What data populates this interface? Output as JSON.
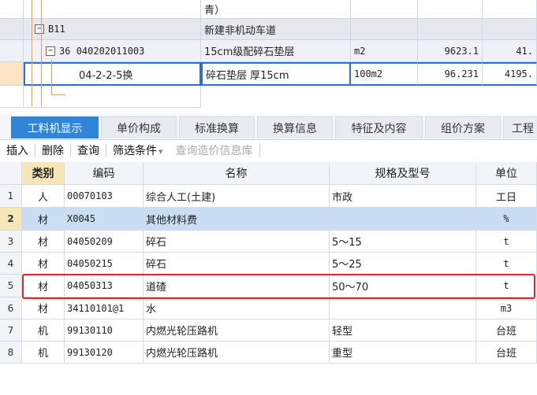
{
  "top_rows": [
    {
      "code": "",
      "name": "青）",
      "unit": "",
      "qty": "",
      "price": ""
    },
    {
      "num": "B11",
      "code": "",
      "name": "新建非机动车道",
      "unit": "",
      "qty": "",
      "price": ""
    },
    {
      "num": "36",
      "code": "040202011003",
      "name": "15cm级配碎石垫层",
      "unit": "m2",
      "qty": "9623.1",
      "price": "41."
    },
    {
      "code": "04-2-2-5换",
      "name": "碎石垫层 厚15cm",
      "unit": "100m2",
      "qty": "96.231",
      "price": "4195."
    }
  ],
  "tabs": [
    "工料机显示",
    "单价构成",
    "标准换算",
    "换算信息",
    "特征及内容",
    "组价方案",
    "工程"
  ],
  "toolbar": {
    "insert": "插入",
    "delete": "删除",
    "query": "查询",
    "filter": "筛选条件",
    "filter_arrow": "▾",
    "price_db": "查询造价信息库"
  },
  "grid_headers": {
    "category": "类别",
    "code": "编码",
    "name": "名称",
    "spec": "规格及型号",
    "unit": "单位"
  },
  "grid_rows": [
    {
      "n": "1",
      "category": "人",
      "code": "00070103",
      "name": "综合人工(土建)",
      "spec": "市政",
      "unit": "工日"
    },
    {
      "n": "2",
      "category": "材",
      "code": "X0045",
      "name": "其他材料费",
      "spec": "",
      "unit": "%"
    },
    {
      "n": "3",
      "category": "材",
      "code": "04050209",
      "name": "碎石",
      "spec": "5～15",
      "unit": "t"
    },
    {
      "n": "4",
      "category": "材",
      "code": "04050215",
      "name": "碎石",
      "spec": "5～25",
      "unit": "t"
    },
    {
      "n": "5",
      "category": "材",
      "code": "04050313",
      "name": "道碴",
      "spec": "50～70",
      "unit": "t"
    },
    {
      "n": "6",
      "category": "材",
      "code": "34110101@1",
      "name": "水",
      "spec": "",
      "unit": "m3"
    },
    {
      "n": "7",
      "category": "机",
      "code": "99130110",
      "name": "内燃光轮压路机",
      "spec": "轻型",
      "unit": "台班"
    },
    {
      "n": "8",
      "category": "机",
      "code": "99130120",
      "name": "内燃光轮压路机",
      "spec": "重型",
      "unit": "台班"
    }
  ],
  "colors": {
    "accent": "#2f86d8",
    "highlight_row": "#c9ddf5",
    "red_box": "#e0242b"
  }
}
